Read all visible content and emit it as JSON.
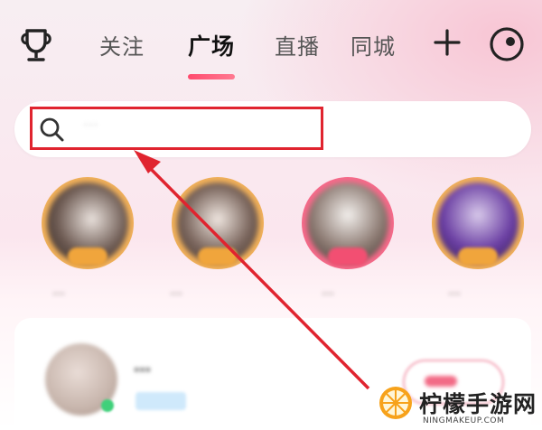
{
  "header": {
    "tabs": [
      {
        "label": "关注",
        "active": false
      },
      {
        "label": "广场",
        "active": true
      },
      {
        "label": "直播",
        "active": false
      },
      {
        "label": "同城",
        "active": false
      }
    ],
    "accent_color": "#ff4a6e"
  },
  "search": {
    "placeholder": "…"
  },
  "stories": [
    {
      "name": "…",
      "ring_color": "#f2b15a"
    },
    {
      "name": "…",
      "ring_color": "#f2b15a"
    },
    {
      "name": "…",
      "ring_color": "#f76a8a"
    },
    {
      "name": "…",
      "ring_color": "#f2b15a"
    }
  ],
  "feed": {
    "user_name": "…"
  },
  "highlight_color": "#e0242f",
  "watermark": {
    "brand": "柠檬手游网",
    "domain": "NINGMAKEUP.COM"
  }
}
